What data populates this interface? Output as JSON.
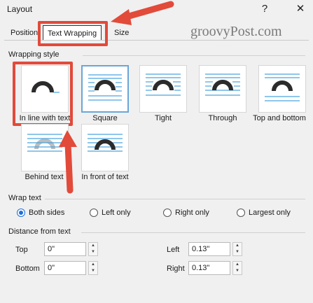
{
  "window": {
    "title": "Layout",
    "help_label": "?",
    "close_label": "✕"
  },
  "watermark": "groovyPost.com",
  "tabs": [
    {
      "label": "Position"
    },
    {
      "label": "Text Wrapping"
    },
    {
      "label": "Size"
    }
  ],
  "wrapping_style": {
    "label": "Wrapping style",
    "items": [
      {
        "label": "In line with text",
        "selected": false
      },
      {
        "label": "Square",
        "selected": true
      },
      {
        "label": "Tight",
        "selected": false
      },
      {
        "label": "Through",
        "selected": false
      },
      {
        "label": "Top and bottom",
        "selected": false
      },
      {
        "label": "Behind text",
        "selected": false
      },
      {
        "label": "In front of text",
        "selected": false
      }
    ]
  },
  "wrap_text": {
    "label": "Wrap text",
    "options": [
      {
        "label": "Both sides",
        "selected": true
      },
      {
        "label": "Left only",
        "selected": false
      },
      {
        "label": "Right only",
        "selected": false
      },
      {
        "label": "Largest only",
        "selected": false
      }
    ]
  },
  "distance": {
    "label": "Distance from text",
    "top": {
      "label": "Top",
      "value": "0\""
    },
    "bottom": {
      "label": "Bottom",
      "value": "0\""
    },
    "left": {
      "label": "Left",
      "value": "0.13\""
    },
    "right": {
      "label": "Right",
      "value": "0.13\""
    }
  },
  "colors": {
    "annotation": "#e24a3a",
    "accent": "#1e6fd9",
    "icon_lines": "#4aa3df",
    "icon_shape": "#2b2b2b"
  },
  "icons": {
    "help": "question-icon",
    "close": "close-icon",
    "arrow_up": "arrow-up-icon",
    "arrow_down": "arrow-down-icon"
  }
}
